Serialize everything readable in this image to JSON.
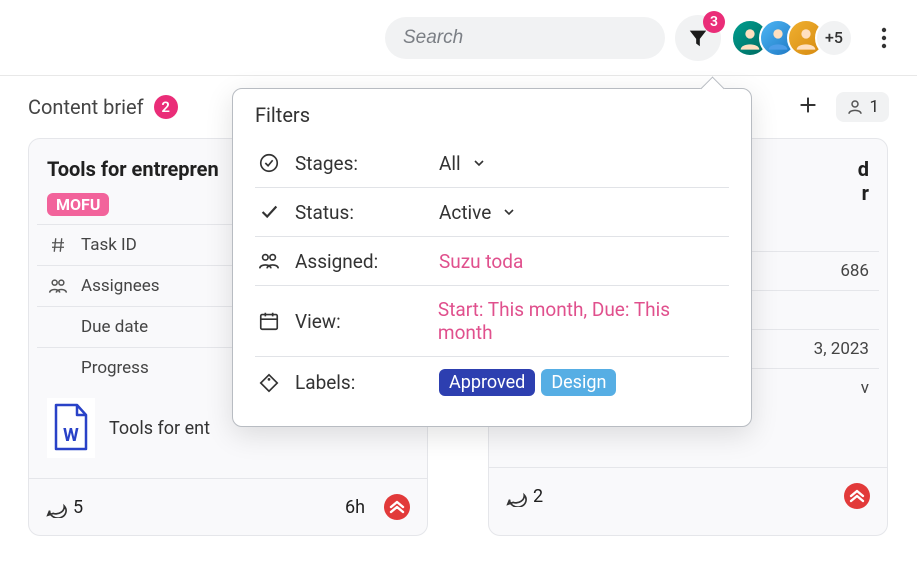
{
  "header": {
    "search_placeholder": "Search",
    "filter_badge": "3",
    "avatar_more": "+5"
  },
  "title": {
    "text": "Content brief",
    "count": "2",
    "member_count": "1"
  },
  "card1": {
    "title": "Tools for entrepren",
    "tag": "MOFU",
    "row_task_id_label": "Task ID",
    "row_assignees_label": "Assignees",
    "row_due_label": "Due date",
    "row_progress_label": "Progress",
    "doc_label": "Tools for ent",
    "comments": "5",
    "time": "6h"
  },
  "card2": {
    "title_l1": "d",
    "title_l2": "r",
    "val_taskid": "686",
    "val_due": "3, 2023",
    "val_prog": "v",
    "comments": "2"
  },
  "filters": {
    "title": "Filters",
    "stages_label": "Stages:",
    "stages_val": "All",
    "status_label": "Status:",
    "status_val": "Active",
    "assigned_label": "Assigned:",
    "assigned_val": "Suzu toda",
    "view_label": "View:",
    "view_val": "Start: This month, Due: This month",
    "labels_label": "Labels:",
    "label_approved": "Approved",
    "label_design": "Design"
  }
}
